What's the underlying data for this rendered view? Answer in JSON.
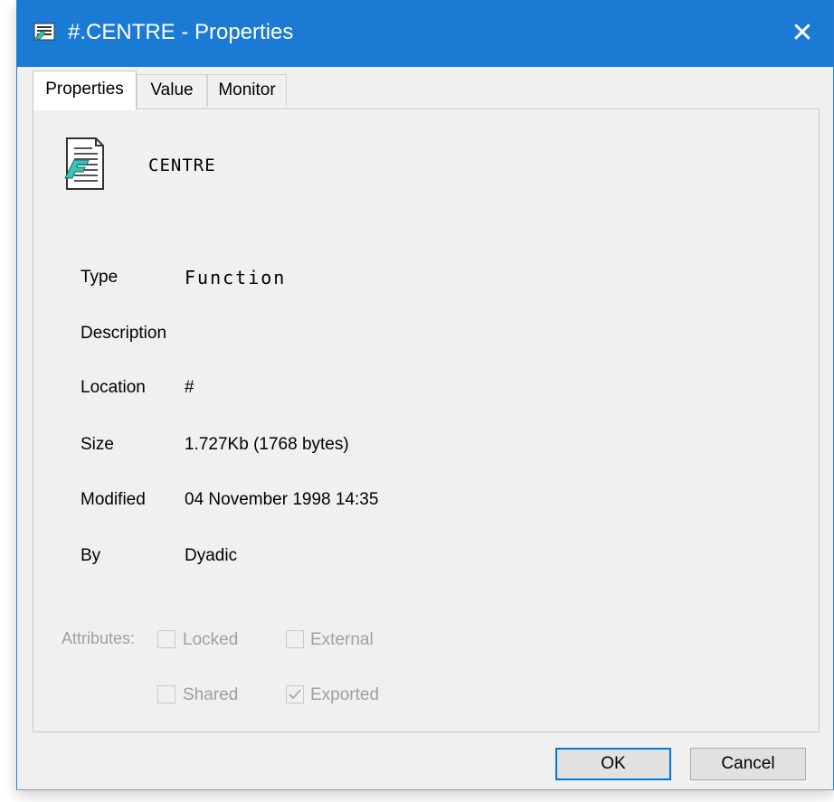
{
  "window": {
    "title": "#.CENTRE - Properties",
    "close_glyph": "✕"
  },
  "tabs": [
    {
      "label": "Properties",
      "active": true
    },
    {
      "label": "Value",
      "active": false
    },
    {
      "label": "Monitor",
      "active": false
    }
  ],
  "object": {
    "name": "CENTRE",
    "icon": "function-document-icon"
  },
  "properties": {
    "type": {
      "label": "Type",
      "value": "Function"
    },
    "description": {
      "label": "Description",
      "value": ""
    },
    "location": {
      "label": "Location",
      "value": "#"
    },
    "size": {
      "label": "Size",
      "value": "1.727Kb (1768 bytes)"
    },
    "modified": {
      "label": "Modified",
      "value": "04 November 1998 14:35"
    },
    "by": {
      "label": "By",
      "value": "Dyadic"
    }
  },
  "attributes": {
    "label": "Attributes:",
    "items": [
      {
        "label": "Locked",
        "checked": false
      },
      {
        "label": "External",
        "checked": false
      },
      {
        "label": "Shared",
        "checked": false
      },
      {
        "label": "Exported",
        "checked": true
      }
    ]
  },
  "buttons": {
    "ok": "OK",
    "cancel": "Cancel"
  },
  "colors": {
    "titlebar": "#1a7ad4",
    "dialog_bg": "#f0f0f0",
    "disabled_text": "#a0a0a0",
    "default_button_border": "#0078d7"
  }
}
